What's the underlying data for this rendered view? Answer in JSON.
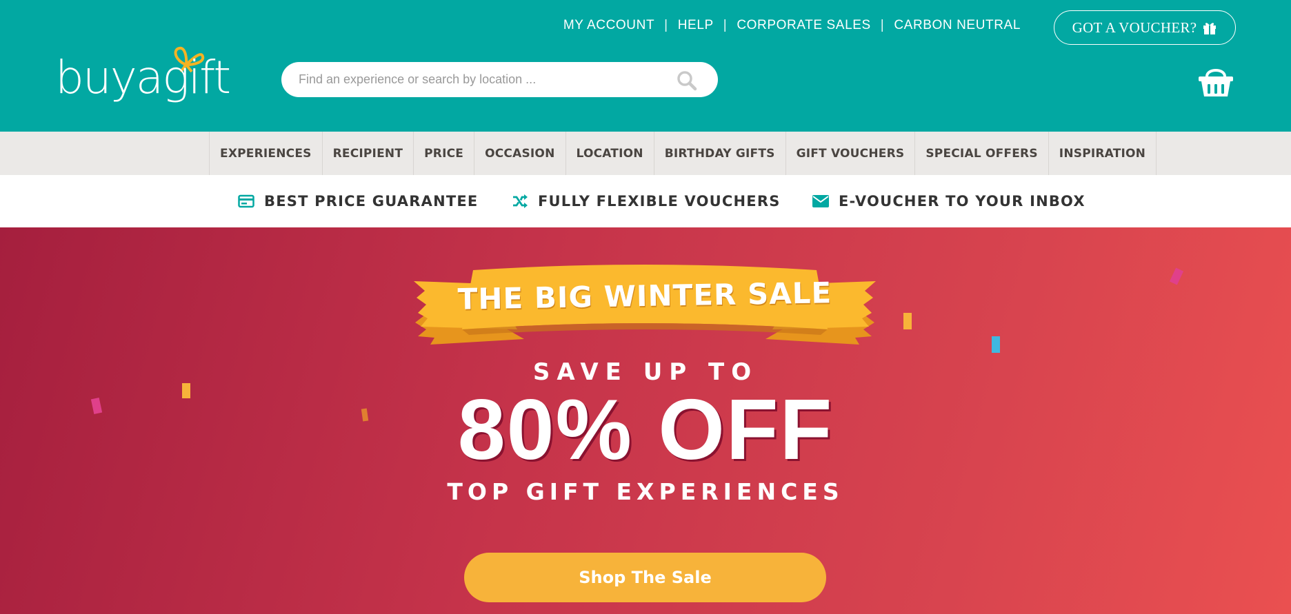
{
  "brand": {
    "logo_text": "buyagift"
  },
  "top_links": [
    "MY ACCOUNT",
    "HELP",
    "CORPORATE SALES",
    "CARBON NEUTRAL"
  ],
  "voucher_button": {
    "label": "GOT A VOUCHER?",
    "icon": "gift-icon"
  },
  "search": {
    "placeholder": "Find an experience or search by location ...",
    "icon": "search-icon"
  },
  "basket": {
    "icon": "basket-icon"
  },
  "nav": {
    "items": [
      "EXPERIENCES",
      "RECIPIENT",
      "PRICE",
      "OCCASION",
      "LOCATION",
      "BIRTHDAY GIFTS",
      "GIFT VOUCHERS",
      "SPECIAL OFFERS",
      "INSPIRATION"
    ]
  },
  "usp": [
    {
      "label": "BEST PRICE GUARANTEE",
      "icon": "credit-card-icon"
    },
    {
      "label": "FULLY FLEXIBLE VOUCHERS",
      "icon": "shuffle-icon"
    },
    {
      "label": "E-VOUCHER TO YOUR INBOX",
      "icon": "envelope-icon"
    }
  ],
  "hero": {
    "banner": "THE BIG WINTER SALE",
    "save_up_to": "SAVE UP TO",
    "discount": "80% OFF",
    "subline": "TOP GIFT EXPERIENCES",
    "cta": "Shop The Sale"
  },
  "colors": {
    "header_teal": "#02a8a2",
    "nav_bg": "#ebe9e7",
    "hero_red": "#c5334a",
    "cta_yellow": "#f7b33a",
    "banner_yellow": "#fbb92e"
  }
}
